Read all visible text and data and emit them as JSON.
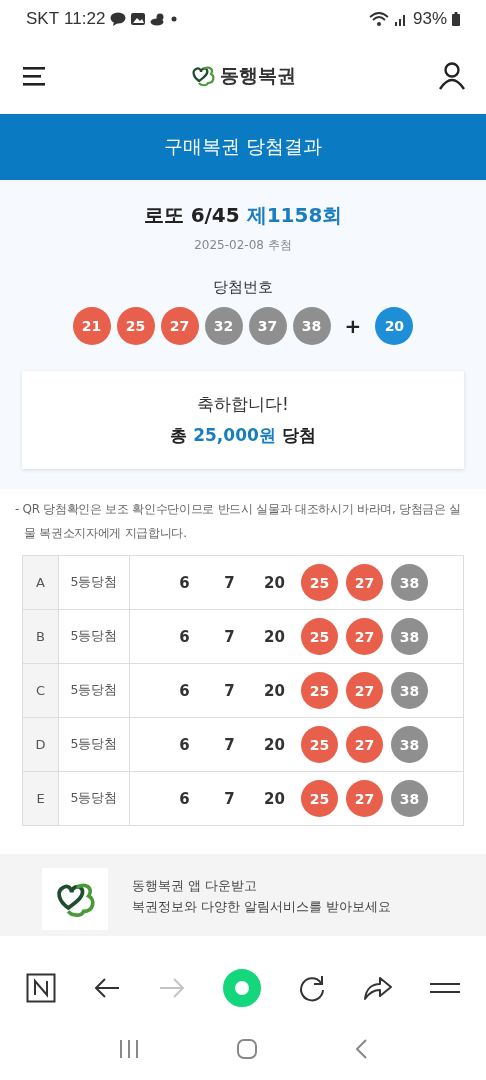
{
  "status_bar": {
    "carrier": "SKT",
    "time": "11:22",
    "battery": "93%"
  },
  "header": {
    "brand": "동행복권"
  },
  "page_title": "구매복권 당첨결과",
  "draw": {
    "game": "로또 6/45",
    "round": "제1158회",
    "date": "2025-02-08 추첨",
    "numbers_label": "당첨번호",
    "plus": "+",
    "numbers": [
      {
        "number": "21",
        "color": "#e8604c"
      },
      {
        "number": "25",
        "color": "#e8604c"
      },
      {
        "number": "27",
        "color": "#e8604c"
      },
      {
        "number": "32",
        "color": "#8f8f8f"
      },
      {
        "number": "37",
        "color": "#8f8f8f"
      },
      {
        "number": "38",
        "color": "#8f8f8f"
      }
    ],
    "bonus": {
      "number": "20",
      "color": "#1e8fd6"
    }
  },
  "result": {
    "message": "축하합니다!",
    "prefix": "총",
    "amount": "25,000원",
    "suffix": "당첨"
  },
  "notice": "- QR 당첨확인은 보조 확인수단이므로 반드시 실물과 대조하시기 바라며, 당첨금은 실물 복권소지자에게 지급합니다.",
  "games": [
    {
      "slot": "A",
      "rank": "5등당첨",
      "numbers": [
        {
          "number": "6",
          "matched": false
        },
        {
          "number": "7",
          "matched": false
        },
        {
          "number": "20",
          "matched": false
        },
        {
          "number": "25",
          "matched": true,
          "color": "#e8604c"
        },
        {
          "number": "27",
          "matched": true,
          "color": "#e8604c"
        },
        {
          "number": "38",
          "matched": true,
          "color": "#8f8f8f"
        }
      ]
    },
    {
      "slot": "B",
      "rank": "5등당첨",
      "numbers": [
        {
          "number": "6",
          "matched": false
        },
        {
          "number": "7",
          "matched": false
        },
        {
          "number": "20",
          "matched": false
        },
        {
          "number": "25",
          "matched": true,
          "color": "#e8604c"
        },
        {
          "number": "27",
          "matched": true,
          "color": "#e8604c"
        },
        {
          "number": "38",
          "matched": true,
          "color": "#8f8f8f"
        }
      ]
    },
    {
      "slot": "C",
      "rank": "5등당첨",
      "numbers": [
        {
          "number": "6",
          "matched": false
        },
        {
          "number": "7",
          "matched": false
        },
        {
          "number": "20",
          "matched": false
        },
        {
          "number": "25",
          "matched": true,
          "color": "#e8604c"
        },
        {
          "number": "27",
          "matched": true,
          "color": "#e8604c"
        },
        {
          "number": "38",
          "matched": true,
          "color": "#8f8f8f"
        }
      ]
    },
    {
      "slot": "D",
      "rank": "5등당첨",
      "numbers": [
        {
          "number": "6",
          "matched": false
        },
        {
          "number": "7",
          "matched": false
        },
        {
          "number": "20",
          "matched": false
        },
        {
          "number": "25",
          "matched": true,
          "color": "#e8604c"
        },
        {
          "number": "27",
          "matched": true,
          "color": "#e8604c"
        },
        {
          "number": "38",
          "matched": true,
          "color": "#8f8f8f"
        }
      ]
    },
    {
      "slot": "E",
      "rank": "5등당첨",
      "numbers": [
        {
          "number": "6",
          "matched": false
        },
        {
          "number": "7",
          "matched": false
        },
        {
          "number": "20",
          "matched": false
        },
        {
          "number": "25",
          "matched": true,
          "color": "#e8604c"
        },
        {
          "number": "27",
          "matched": true,
          "color": "#e8604c"
        },
        {
          "number": "38",
          "matched": true,
          "color": "#8f8f8f"
        }
      ]
    }
  ],
  "app_promo": {
    "lines": [
      "동행복권 앱 다운받고",
      "복권정보와 다양한 알림서비스를 받아보세요"
    ]
  },
  "browser_toolbar": {
    "forward_disabled": true
  }
}
